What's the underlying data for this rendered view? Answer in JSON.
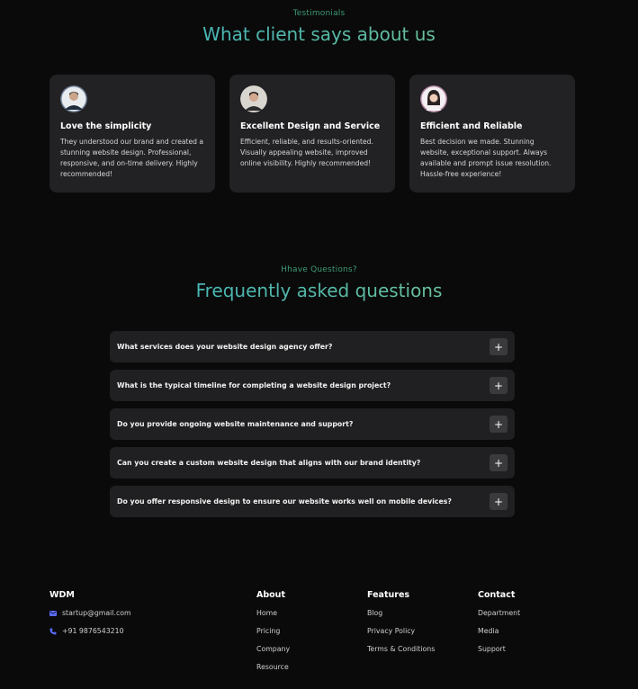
{
  "testimonials": {
    "eyebrow": "Testimonials",
    "title": "What client says about us",
    "cards": [
      {
        "title": "Love the simplicity",
        "text": "They understood our brand and created a stunning website design. Professional, responsive, and on-time delivery. Highly recommended!"
      },
      {
        "title": "Excellent Design and Service",
        "text": "Efficient, reliable, and results-oriented. Visually appealing website, improved online visibility. Highly recommended!"
      },
      {
        "title": "Efficient and Reliable",
        "text": "Best decision we made. Stunning website, exceptional support. Always available and prompt issue resolution. Hassle-free experience!"
      }
    ]
  },
  "faq": {
    "eyebrow": "Hhave Questions?",
    "title": "Frequently asked questions",
    "items": [
      {
        "q": "What services does your website design agency offer?",
        "icon": "+"
      },
      {
        "q": "What is the typical timeline for completing a website design project?",
        "icon": "+"
      },
      {
        "q": "Do you provide ongoing website maintenance and support?",
        "icon": "+"
      },
      {
        "q": "Can you create a custom website design that aligns with our brand identity?",
        "icon": "+"
      },
      {
        "q": "Do you offer responsive design to ensure our website works well on mobile devices?",
        "icon": "+"
      }
    ]
  },
  "footer": {
    "brand": "WDM",
    "email": "startup@gmail.com",
    "phone": "+91 9876543210",
    "about": {
      "title": "About",
      "links": [
        "Home",
        "Pricing",
        "Company",
        "Resource"
      ]
    },
    "features": {
      "title": "Features",
      "links": [
        "Blog",
        "Privacy Policy",
        "Terms & Conditions"
      ]
    },
    "contact": {
      "title": "Contact",
      "links": [
        "Department",
        "Media",
        "Support"
      ]
    }
  },
  "colors": {
    "accent_green": "#3d9a73",
    "icon_blue": "#5b6cff",
    "card_bg": "#222224"
  }
}
